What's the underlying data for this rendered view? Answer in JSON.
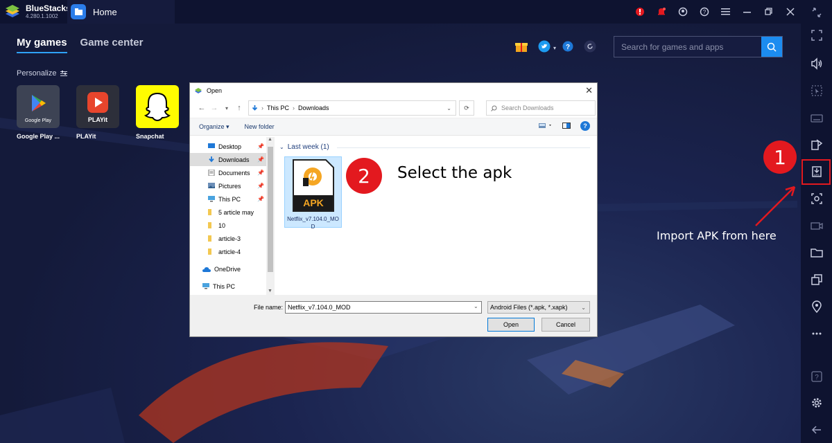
{
  "app": {
    "name": "BlueStacks",
    "version": "4.280.1.1002",
    "tab_home": "Home"
  },
  "tabs": {
    "my_games": "My games",
    "game_center": "Game center"
  },
  "search": {
    "placeholder": "Search for games and apps"
  },
  "personalize": "Personalize",
  "games": [
    {
      "name": "Google Play ...",
      "tile_caption": "Google Play"
    },
    {
      "name": "PLAYit",
      "tile_caption": "PLAYit"
    },
    {
      "name": "Snapchat"
    }
  ],
  "dialog": {
    "title": "Open",
    "breadcrumb": [
      "This PC",
      "Downloads"
    ],
    "search_placeholder": "Search Downloads",
    "toolbar": {
      "organize": "Organize ▾",
      "new_folder": "New folder"
    },
    "nav": [
      {
        "label": "Desktop",
        "pinned": true
      },
      {
        "label": "Downloads",
        "pinned": true,
        "selected": true
      },
      {
        "label": "Documents",
        "pinned": true
      },
      {
        "label": "Pictures",
        "pinned": true
      },
      {
        "label": "This PC",
        "pinned": true
      },
      {
        "label": "5 article may"
      },
      {
        "label": "10"
      },
      {
        "label": "article-3"
      },
      {
        "label": "article-4"
      },
      {
        "label": "OneDrive"
      },
      {
        "label": "This PC"
      }
    ],
    "group_header": "Last week (1)",
    "file": {
      "name": "Netflix_v7.104.0_MOD",
      "badge": "APK"
    },
    "file_name_label": "File name:",
    "file_name_value": "Netflix_v7.104.0_MOD",
    "file_type": "Android Files (*.apk, *.xapk)",
    "open_button": "Open",
    "cancel_button": "Cancel"
  },
  "annotations": {
    "step1": "1",
    "step2": "2",
    "step2_text": "Select the apk",
    "import_text": "Import APK from here",
    "color": "#e3191f"
  }
}
